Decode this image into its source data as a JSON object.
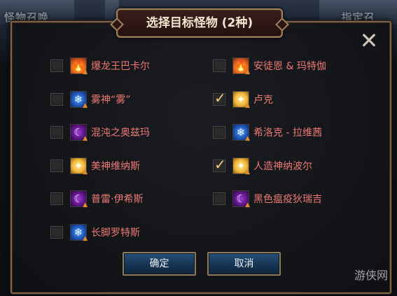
{
  "background": {
    "left_tab_label": "怪物召唤",
    "right_tab_label": "指定召"
  },
  "dialog": {
    "title": "选择目标怪物 (2种)",
    "close_glyph": "✕",
    "confirm_label": "确定",
    "cancel_label": "取消"
  },
  "options": [
    {
      "label": "爆龙王巴卡尔",
      "element": "fire",
      "icon_glyph": "🔥",
      "checked": false
    },
    {
      "label": "安徒恩 & 玛特伽",
      "element": "fire",
      "icon_glyph": "🔥",
      "checked": false
    },
    {
      "label": "雾神“雾”",
      "element": "ice",
      "icon_glyph": "❄",
      "checked": false
    },
    {
      "label": "卢克",
      "element": "light",
      "icon_glyph": "✦",
      "checked": true
    },
    {
      "label": "混沌之奥兹玛",
      "element": "dark",
      "icon_glyph": "☾",
      "checked": false
    },
    {
      "label": "希洛克 - 拉维茜",
      "element": "ice",
      "icon_glyph": "❄",
      "checked": false
    },
    {
      "label": "美神维纳斯",
      "element": "light",
      "icon_glyph": "✦",
      "checked": false
    },
    {
      "label": "人造神纳波尔",
      "element": "light",
      "icon_glyph": "✦",
      "checked": true
    },
    {
      "label": "普雷·伊希斯",
      "element": "dark",
      "icon_glyph": "☾",
      "checked": false
    },
    {
      "label": "黑色瘟疫狄瑞吉",
      "element": "dark",
      "icon_glyph": "☾",
      "checked": false
    },
    {
      "label": "长脚罗特斯",
      "element": "ice",
      "icon_glyph": "❄",
      "checked": false
    }
  ],
  "watermark": "游侠网"
}
